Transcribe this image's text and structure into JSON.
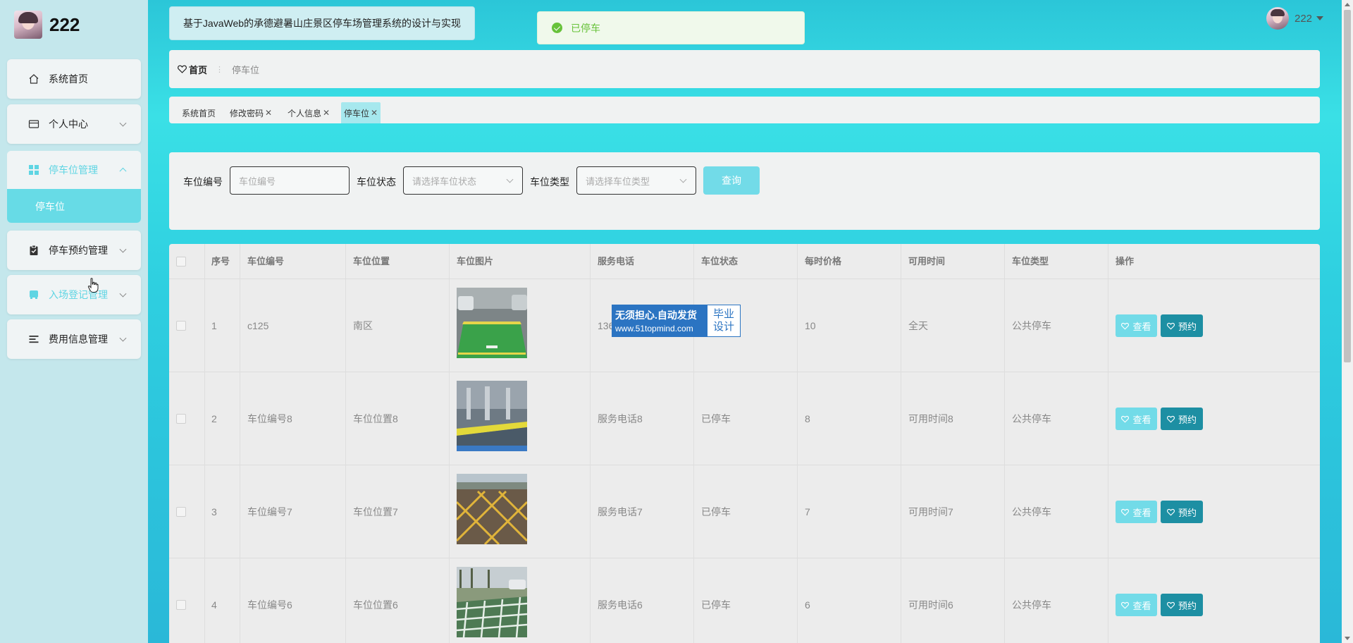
{
  "app": {
    "user_name": "222",
    "system_title": "基于JavaWeb的承德避暑山庄景区停车场管理系统的设计与实现",
    "toast_message": "已停车",
    "accent_color": "#5fd5e3",
    "book_color": "#1d8fa3",
    "success_color": "#67c23a"
  },
  "sidebar": {
    "items": [
      {
        "label": "系统首页",
        "icon": "home-icon"
      },
      {
        "label": "个人中心",
        "icon": "card-icon"
      },
      {
        "label": "停车位管理",
        "icon": "grid-icon"
      },
      {
        "label": "停车预约管理",
        "icon": "clipboard-icon"
      },
      {
        "label": "入场登记管理",
        "icon": "bus-icon"
      },
      {
        "label": "费用信息管理",
        "icon": "list-icon"
      }
    ],
    "sub_item": "停车位"
  },
  "breadcrumb": {
    "home": "首页",
    "current": "停车位"
  },
  "tags": [
    {
      "label": "系统首页"
    },
    {
      "label": "修改密码"
    },
    {
      "label": "个人信息"
    },
    {
      "label": "停车位"
    }
  ],
  "search": {
    "label_number": "车位编号",
    "placeholder_number": "车位编号",
    "label_status": "车位状态",
    "placeholder_status": "请选择车位状态",
    "label_type": "车位类型",
    "placeholder_type": "请选择车位类型",
    "button": "查询"
  },
  "table": {
    "headers": [
      "序号",
      "车位编号",
      "车位位置",
      "车位图片",
      "服务电话",
      "车位状态",
      "每时价格",
      "可用时间",
      "车位类型",
      "操作"
    ],
    "rows": [
      {
        "index": "1",
        "number": "c125",
        "location": "南区",
        "phone": "136",
        "status": "",
        "price": "10",
        "time": "全天",
        "type": "公共停车"
      },
      {
        "index": "2",
        "number": "车位编号8",
        "location": "车位位置8",
        "phone": "服务电话8",
        "status": "已停车",
        "price": "8",
        "time": "可用时间8",
        "type": "公共停车"
      },
      {
        "index": "3",
        "number": "车位编号7",
        "location": "车位位置7",
        "phone": "服务电话7",
        "status": "已停车",
        "price": "7",
        "time": "可用时间7",
        "type": "公共停车"
      },
      {
        "index": "4",
        "number": "车位编号6",
        "location": "车位位置6",
        "phone": "服务电话6",
        "status": "已停车",
        "price": "6",
        "time": "可用时间6",
        "type": "公共停车"
      }
    ],
    "view_label": "查看",
    "book_label": "预约"
  },
  "watermark": {
    "line1": "无须担心.自动发货",
    "line2": "www.51topmind.com",
    "right1": "毕业",
    "right2": "设计"
  }
}
